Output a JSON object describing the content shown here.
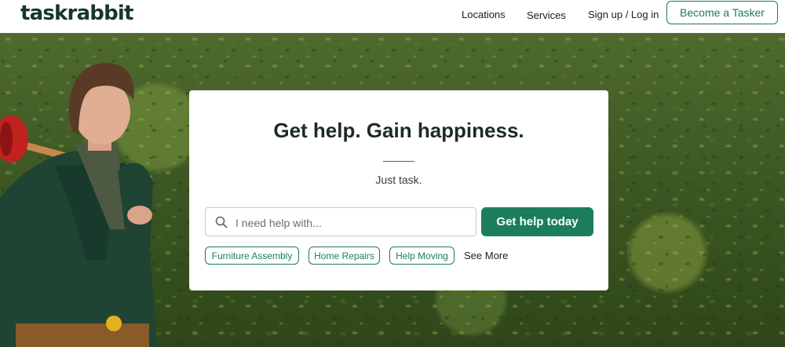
{
  "header": {
    "logo": "taskrabbit",
    "nav": [
      "Locations",
      "Services",
      "Sign up / Log in"
    ],
    "cta": "Become a Tasker"
  },
  "hero": {
    "headline": "Get help. Gain happiness.",
    "tagline": "Just task.",
    "search": {
      "placeholder": "I need help with...",
      "value": ""
    },
    "submit_label": "Get help today",
    "chips": [
      "Furniture Assembly",
      "Home Repairs",
      "Help Moving"
    ],
    "see_more": "See More"
  },
  "icons": {
    "search": "search-icon"
  },
  "colors": {
    "brand": "#1b7d5e",
    "logo": "#16382b",
    "headline": "#1c2b28"
  }
}
